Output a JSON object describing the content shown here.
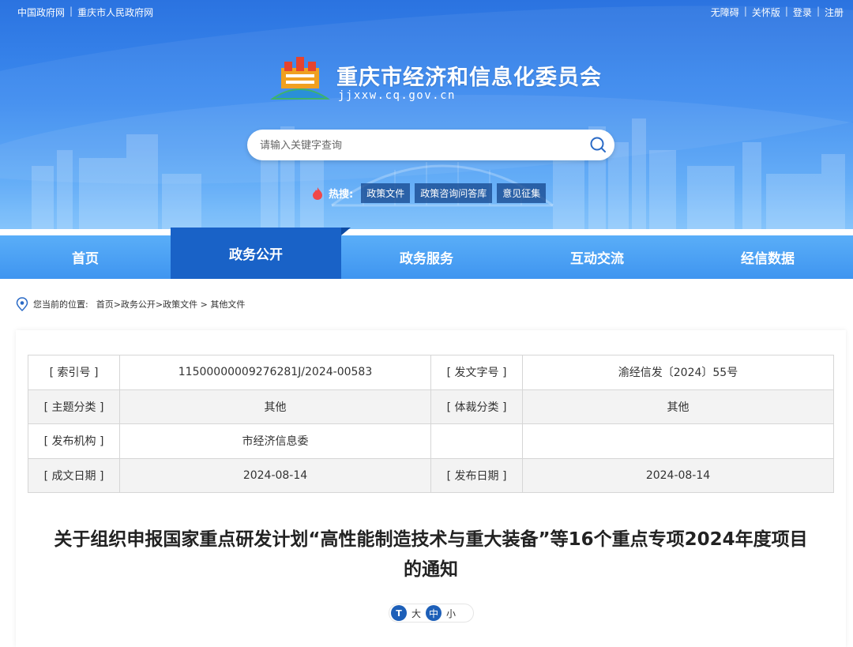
{
  "topbar": {
    "left_links": [
      "中国政府网",
      "重庆市人民政府网"
    ],
    "right_links": [
      "无障碍",
      "关怀版",
      "登录",
      "注册"
    ]
  },
  "header": {
    "title": "重庆市经济和信息化委员会",
    "domain": "jjxxw.cq.gov.cn"
  },
  "search": {
    "placeholder": "请输入关键字查询"
  },
  "hot_search": {
    "label": "热搜:",
    "items": [
      "政策文件",
      "政策咨询问答库",
      "意见征集"
    ]
  },
  "nav": {
    "items": [
      "首页",
      "政务公开",
      "政务服务",
      "互动交流",
      "经信数据"
    ],
    "active": "政务公开"
  },
  "breadcrumb": {
    "lead": "您当前的位置:",
    "path": "首页>政务公开>政策文件 > 其他文件"
  },
  "meta": {
    "rows": [
      {
        "k1": "[ 索引号 ]",
        "v1": "11500000009276281J/2024-00583",
        "k2": "[ 发文字号 ]",
        "v2": "渝经信发〔2024〕55号"
      },
      {
        "k1": "[ 主题分类 ]",
        "v1": "其他",
        "k2": "[ 体裁分类 ]",
        "v2": "其他"
      },
      {
        "k1": "[ 发布机构 ]",
        "v1": "市经济信息委",
        "k2": "",
        "v2": ""
      },
      {
        "k1": "[ 成文日期 ]",
        "v1": "2024-08-14",
        "k2": "[ 发布日期 ]",
        "v2": "2024-08-14"
      }
    ]
  },
  "document": {
    "title_line1": "关于组织申报国家重点研发计划“高性能制造技术与重大装备”等16个重点专项2024年度项目",
    "title_line2": "的通知"
  },
  "font_size": {
    "badge": "T",
    "options": [
      "大",
      "中",
      "小"
    ],
    "selected": "中"
  },
  "colors": {
    "banner_top": "#2b73e0",
    "nav_active": "#1962c7",
    "nav_bg": "#4aa0f4"
  }
}
